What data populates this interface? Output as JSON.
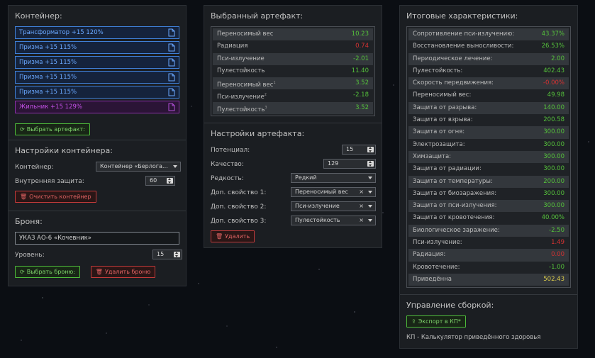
{
  "container": {
    "title": "Контейнер:",
    "slots": [
      {
        "label": "Трансформатор +15 120%",
        "color": "blue"
      },
      {
        "label": "Призма +15 115%",
        "color": "blue"
      },
      {
        "label": "Призма +15 115%",
        "color": "blue"
      },
      {
        "label": "Призма +15 115%",
        "color": "blue"
      },
      {
        "label": "Призма +15 115%",
        "color": "blue"
      },
      {
        "label": "Жильник +15 129%",
        "color": "purple"
      }
    ],
    "select_artifact_button": "Выбрать артефакт:"
  },
  "container_settings": {
    "title": "Настройки контейнера:",
    "container_label": "Контейнер:",
    "container_value": "Контейнер «Берлога…",
    "inner_protection_label": "Внутренняя защита:",
    "inner_protection_value": "60",
    "clear_button": "Очистить контейнер"
  },
  "armor": {
    "title": "Броня:",
    "name": "УКАЗ АО-6 «Кочевник»",
    "level_label": "Уровень:",
    "level_value": "15",
    "select_button": "Выбрать броню:",
    "delete_button": "Удалить броню"
  },
  "selected_artifact": {
    "title": "Выбранный артефакт:",
    "rows": [
      {
        "label": "Переносимый вес",
        "sup": "",
        "value": "10.23",
        "tone": "g"
      },
      {
        "label": "Радиация",
        "sup": "",
        "value": "0.74",
        "tone": "r"
      },
      {
        "label": "Пси-излучение",
        "sup": "",
        "value": "-2.01",
        "tone": "g"
      },
      {
        "label": "Пулестойкость",
        "sup": "",
        "value": "11.40",
        "tone": "g"
      },
      {
        "label": "Переносимый вес",
        "sup": "1",
        "value": "3.52",
        "tone": "g"
      },
      {
        "label": "Пси-излучение",
        "sup": "2",
        "value": "-2.18",
        "tone": "g"
      },
      {
        "label": "Пулестойкость",
        "sup": "3",
        "value": "3.52",
        "tone": "g"
      }
    ]
  },
  "artifact_settings": {
    "title": "Настройки артефакта:",
    "potential_label": "Потенциал:",
    "potential_value": "15",
    "quality_label": "Качество:",
    "quality_value": "129",
    "rarity_label": "Редкость:",
    "rarity_value": "Редкий",
    "prop1_label": "Доп. свойство 1:",
    "prop1_value": "Переносимый вес",
    "prop2_label": "Доп. свойство 2:",
    "prop2_value": "Пси-излучение",
    "prop3_label": "Доп. свойство 3:",
    "prop3_value": "Пулестойкость",
    "clear_symbol": "×",
    "delete_button": "Удалить"
  },
  "totals": {
    "title": "Итоговые характеристики:",
    "rows": [
      {
        "label": "Сопротивление пси-излучению:",
        "value": "43.37%",
        "tone": "g"
      },
      {
        "label": "Восстановление выносливости:",
        "value": "26.53%",
        "tone": "g"
      },
      {
        "label": "Периодическое лечение:",
        "value": "2.00",
        "tone": "g"
      },
      {
        "label": "Пулестойкость:",
        "value": "402.43",
        "tone": "g"
      },
      {
        "label": "Скорость передвижения:",
        "value": "-0.00%",
        "tone": "r"
      },
      {
        "label": "Переносимый вес:",
        "value": "49.98",
        "tone": "g"
      },
      {
        "label": "Защита от разрыва:",
        "value": "140.00",
        "tone": "g"
      },
      {
        "label": "Защита от взрыва:",
        "value": "200.58",
        "tone": "g"
      },
      {
        "label": "Защита от огня:",
        "value": "300.00",
        "tone": "g"
      },
      {
        "label": "Электрозащита:",
        "value": "300.00",
        "tone": "g"
      },
      {
        "label": "Химзащита:",
        "value": "300.00",
        "tone": "g"
      },
      {
        "label": "Защита от радиации:",
        "value": "300.00",
        "tone": "g"
      },
      {
        "label": "Защита от температуры:",
        "value": "200.00",
        "tone": "g"
      },
      {
        "label": "Защита от биозаражения:",
        "value": "300.00",
        "tone": "g"
      },
      {
        "label": "Защита от пси-излучения:",
        "value": "300.00",
        "tone": "g"
      },
      {
        "label": "Защита от кровотечения:",
        "value": "40.00%",
        "tone": "g"
      },
      {
        "label": "Биологическое заражение:",
        "value": "-2.50",
        "tone": "g"
      },
      {
        "label": "Пси-излучение:",
        "value": "1.49",
        "tone": "r"
      },
      {
        "label": "Радиация:",
        "value": "0.00",
        "tone": "r"
      },
      {
        "label": "Кровотечение:",
        "value": "-1.00",
        "tone": "g"
      },
      {
        "label": "Приведённа",
        "value": "502.43",
        "tone": "y"
      }
    ]
  },
  "build": {
    "title": "Управление сборкой:",
    "export_button": "Экспорт в КП*",
    "footnote": "КП - Калькулятор приведённого здоровья"
  }
}
